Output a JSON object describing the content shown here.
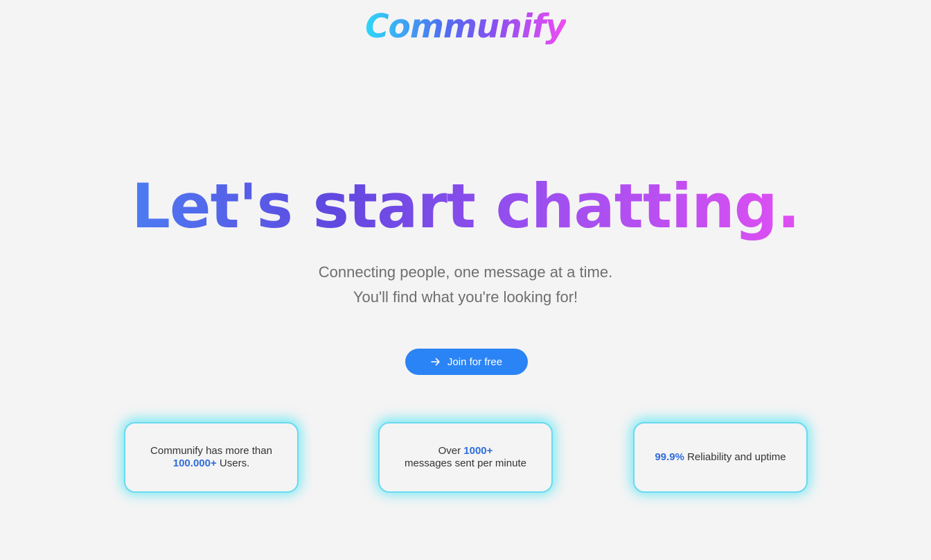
{
  "logo": {
    "text": "Communify"
  },
  "hero": {
    "title": "Let's start chatting.",
    "subtitle_line1": "Connecting people, one message at a time.",
    "subtitle_line2": "You'll find what you're looking for!"
  },
  "cta": {
    "label": "Join for free",
    "icon": "arrow-right-icon",
    "color": "#2b84f5"
  },
  "stats": [
    {
      "prefix": "Communify has more than",
      "highlight": "100.000+",
      "suffix": "Users."
    },
    {
      "prefix": "Over",
      "highlight": "1000+",
      "suffix": "messages sent per minute"
    },
    {
      "highlight": "99.9%",
      "suffix": "Reliability and uptime"
    }
  ],
  "colors": {
    "background": "#f4f4f4",
    "highlight": "#2f6ddb",
    "card_glow": "#5ce8f5",
    "gradient_start": "#4b7cf2",
    "gradient_end": "#e04ff2"
  }
}
